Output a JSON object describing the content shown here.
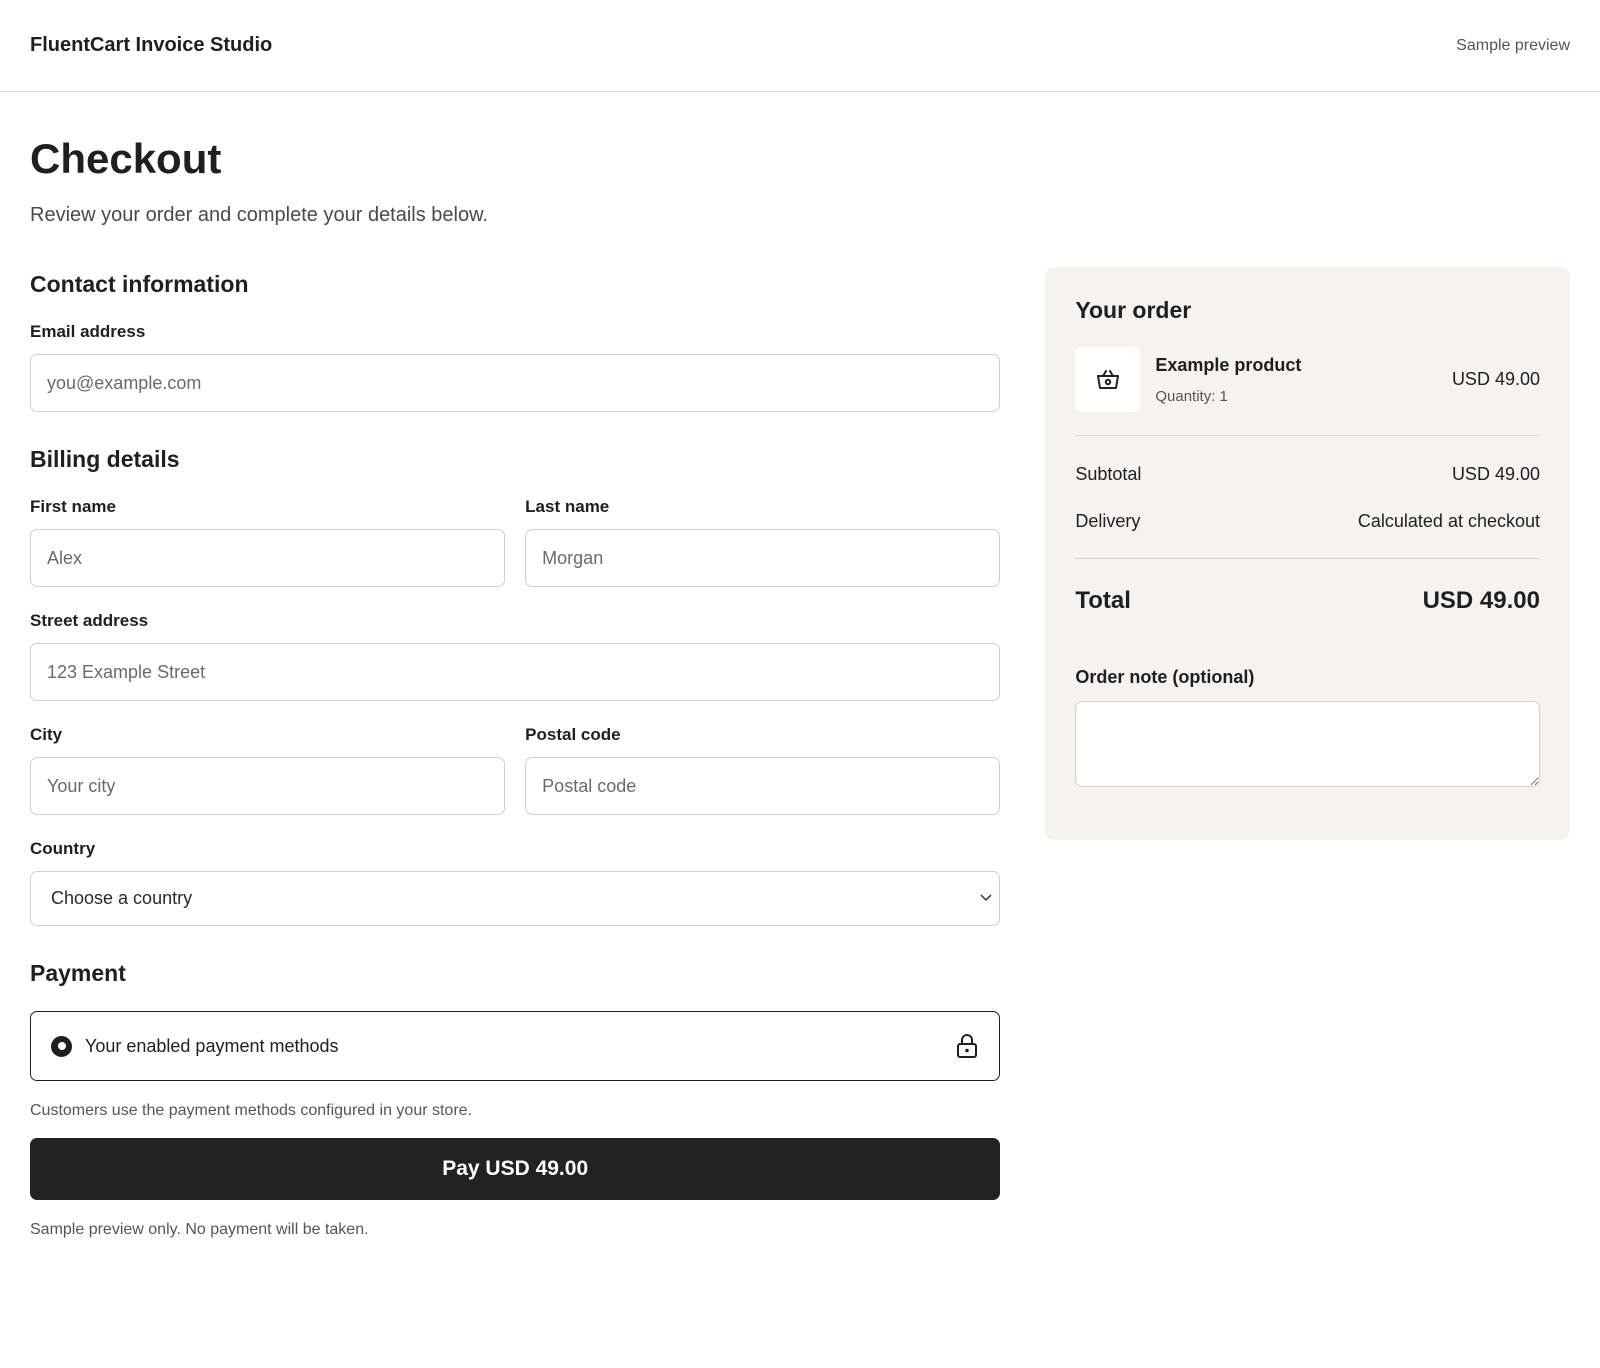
{
  "header": {
    "brand": "FluentCart Invoice Studio",
    "preview": "Sample preview"
  },
  "page": {
    "title": "Checkout",
    "subtitle": "Review your order and complete your details below."
  },
  "contact": {
    "title": "Contact information",
    "email_label": "Email address",
    "email_placeholder": "you@example.com"
  },
  "billing": {
    "title": "Billing details",
    "first_name_label": "First name",
    "first_name_placeholder": "Alex",
    "last_name_label": "Last name",
    "last_name_placeholder": "Morgan",
    "street_label": "Street address",
    "street_placeholder": "123 Example Street",
    "city_label": "City",
    "city_placeholder": "Your city",
    "postal_label": "Postal code",
    "postal_placeholder": "Postal code",
    "country_label": "Country",
    "country_selected": "Choose a country"
  },
  "payment": {
    "title": "Payment",
    "method_label": "Your enabled payment methods",
    "note": "Customers use the payment methods configured in your store.",
    "pay_button": "Pay USD 49.00",
    "fine_print": "Sample preview only. No payment will be taken."
  },
  "order": {
    "title": "Your order",
    "product_name": "Example product",
    "product_qty": "Quantity: 1",
    "product_price": "USD 49.00",
    "subtotal_label": "Subtotal",
    "subtotal_value": "USD 49.00",
    "delivery_label": "Delivery",
    "delivery_value": "Calculated at checkout",
    "total_label": "Total",
    "total_value": "USD 49.00",
    "note_label": "Order note (optional)"
  },
  "icons": {
    "product": "basket-icon",
    "payment": "lock-icon",
    "select": "chevron-down-icon"
  },
  "colors": {
    "accent": "#222222",
    "panel": "#f4f3ee",
    "border": "#cfcfcf"
  }
}
